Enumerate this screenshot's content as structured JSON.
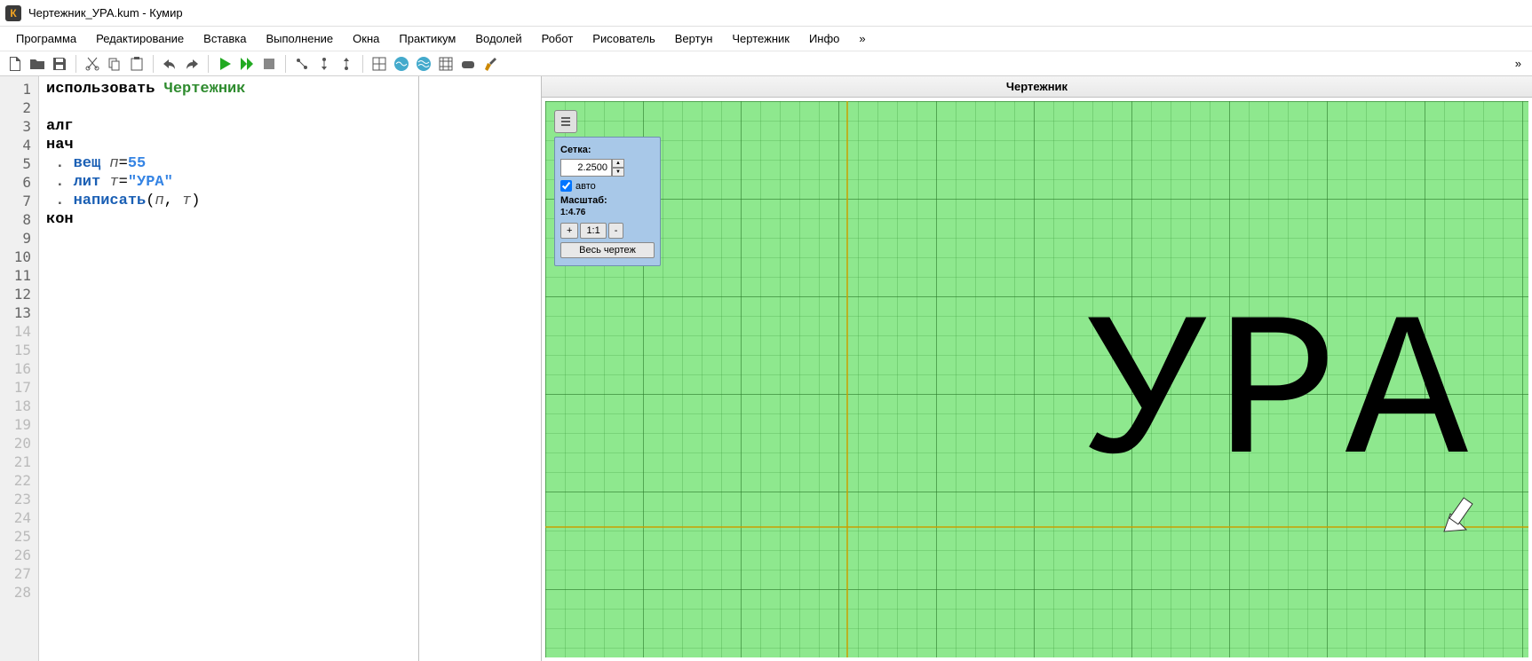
{
  "window": {
    "title": "Чертежник_УРА.kum - Кумир",
    "icon_letter": "К"
  },
  "menu": {
    "items": [
      "Программа",
      "Редактирование",
      "Вставка",
      "Выполнение",
      "Окна",
      "Практикум",
      "Водолей",
      "Робот",
      "Рисователь",
      "Вертун",
      "Чертежник",
      "Инфо"
    ],
    "overflow": "»"
  },
  "toolbar": {
    "overflow": "»"
  },
  "editor": {
    "line_count": 28,
    "code": {
      "l1_kw": "использовать ",
      "l1_module": "Чертежник",
      "l3": "алг",
      "l4": "нач",
      "l5_kw": "вещ",
      "l5_var": "п",
      "l5_eq": "=",
      "l5_val": "55",
      "l6_kw": "лит",
      "l6_var": "т",
      "l6_eq": "=",
      "l6_val": "\"УРА\"",
      "l7_kw": "написать",
      "l7_args_open": "(",
      "l7_var1": "п",
      "l7_comma": ", ",
      "l7_var2": "т",
      "l7_args_close": ")",
      "l8": "кон"
    }
  },
  "canvas": {
    "title": "Чертежник",
    "panel": {
      "grid_label": "Сетка:",
      "grid_value": "2.2500",
      "auto_checked": true,
      "auto_label": "авто",
      "scale_label": "Масштаб:",
      "scale_value": "1:4.76",
      "plus": "+",
      "one_one": "1:1",
      "minus": "-",
      "full": "Весь чертеж"
    },
    "drawn_text": "УРА"
  }
}
